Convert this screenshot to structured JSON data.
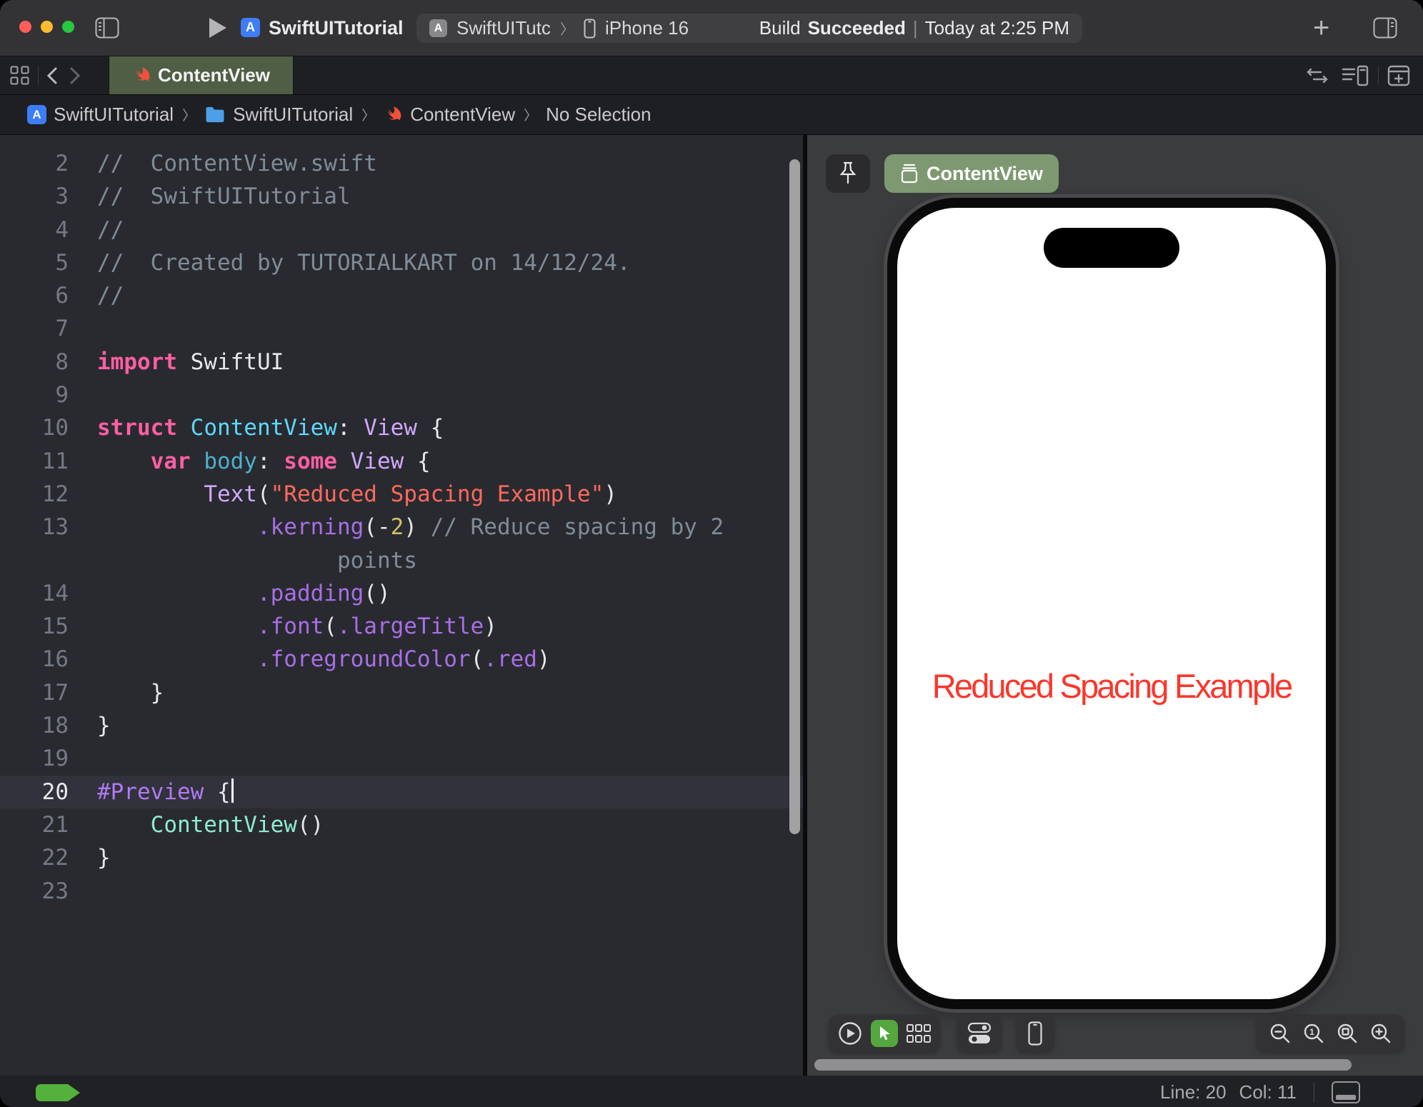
{
  "toolbar": {
    "app_title": "SwiftUITutorial",
    "scheme_name": "SwiftUITutc",
    "scheme_chevron": "〉",
    "device": "iPhone 16",
    "build_label": "Build",
    "build_status": "Succeeded",
    "build_sep": "|",
    "build_time": "Today at 2:25 PM",
    "plus_label": "+"
  },
  "tab_bar": {
    "active_tab": "ContentView"
  },
  "breadcrumb": {
    "items": [
      {
        "icon": "app-icon",
        "label": "SwiftUITutorial"
      },
      {
        "icon": "folder-icon",
        "label": "SwiftUITutorial"
      },
      {
        "icon": "swift-icon",
        "label": "ContentView"
      },
      {
        "icon": "",
        "label": "No Selection"
      }
    ]
  },
  "editor": {
    "lines": [
      {
        "num": "2",
        "tokens": [
          [
            "//  ContentView.swift",
            "comment"
          ]
        ]
      },
      {
        "num": "3",
        "tokens": [
          [
            "//  SwiftUITutorial",
            "comment"
          ]
        ]
      },
      {
        "num": "4",
        "tokens": [
          [
            "//",
            "comment"
          ]
        ]
      },
      {
        "num": "5",
        "tokens": [
          [
            "//  Created by TUTORIALKART on 14/12/24.",
            "comment"
          ]
        ]
      },
      {
        "num": "6",
        "tokens": [
          [
            "//",
            "comment"
          ]
        ]
      },
      {
        "num": "7",
        "tokens": []
      },
      {
        "num": "8",
        "tokens": [
          [
            "import",
            "kw"
          ],
          [
            " SwiftUI",
            "plain"
          ]
        ]
      },
      {
        "num": "9",
        "tokens": []
      },
      {
        "num": "10",
        "tokens": [
          [
            "struct ",
            "kw"
          ],
          [
            "ContentView",
            "type"
          ],
          [
            ": ",
            "plain"
          ],
          [
            "View",
            "typeref"
          ],
          [
            " {",
            "plain"
          ]
        ]
      },
      {
        "num": "11",
        "tokens": [
          [
            "    ",
            "plain"
          ],
          [
            "var ",
            "kw"
          ],
          [
            "body",
            "proj"
          ],
          [
            ": ",
            "plain"
          ],
          [
            "some ",
            "kw"
          ],
          [
            "View",
            "typeref"
          ],
          [
            " {",
            "plain"
          ]
        ]
      },
      {
        "num": "12",
        "tokens": [
          [
            "        ",
            "plain"
          ],
          [
            "Text",
            "typeref"
          ],
          [
            "(",
            "plain"
          ],
          [
            "\"Reduced Spacing Example\"",
            "str"
          ],
          [
            ")",
            "plain"
          ]
        ]
      },
      {
        "num": "13",
        "tokens": [
          [
            "            ",
            "plain"
          ],
          [
            ".kerning",
            "member"
          ],
          [
            "(",
            "plain"
          ],
          [
            "-",
            "plain"
          ],
          [
            "2",
            "num"
          ],
          [
            ") ",
            "plain"
          ],
          [
            "// Reduce spacing by 2",
            "comment"
          ]
        ]
      },
      {
        "num": "",
        "tokens": [
          [
            "                  ",
            "plain"
          ],
          [
            "points",
            "comment"
          ]
        ]
      },
      {
        "num": "14",
        "tokens": [
          [
            "            ",
            "plain"
          ],
          [
            ".padding",
            "member"
          ],
          [
            "()",
            "plain"
          ]
        ]
      },
      {
        "num": "15",
        "tokens": [
          [
            "            ",
            "plain"
          ],
          [
            ".font",
            "member"
          ],
          [
            "(",
            "plain"
          ],
          [
            ".largeTitle",
            "member"
          ],
          [
            ")",
            "plain"
          ]
        ]
      },
      {
        "num": "16",
        "tokens": [
          [
            "            ",
            "plain"
          ],
          [
            ".foregroundColor",
            "member"
          ],
          [
            "(",
            "plain"
          ],
          [
            ".red",
            "member"
          ],
          [
            ")",
            "plain"
          ]
        ]
      },
      {
        "num": "17",
        "tokens": [
          [
            "    }",
            "plain"
          ]
        ]
      },
      {
        "num": "18",
        "tokens": [
          [
            "}",
            "plain"
          ]
        ]
      },
      {
        "num": "19",
        "tokens": []
      },
      {
        "num": "20",
        "active": true,
        "tokens": [
          [
            "#Preview",
            "macro"
          ],
          [
            " {",
            "plain"
          ],
          [
            "",
            "caret"
          ]
        ]
      },
      {
        "num": "21",
        "tokens": [
          [
            "    ",
            "plain"
          ],
          [
            "ContentView",
            "mint"
          ],
          [
            "()",
            "plain"
          ]
        ]
      },
      {
        "num": "22",
        "tokens": [
          [
            "}",
            "plain"
          ]
        ]
      },
      {
        "num": "23",
        "tokens": []
      }
    ]
  },
  "preview": {
    "pill_label": "ContentView",
    "canvas_text": "Reduced Spacing Example"
  },
  "status_bar": {
    "line": "Line: 20",
    "col": "Col: 11"
  },
  "colors": {
    "tab_active_green": "#4f5e44",
    "preview_pill_green": "#7e9971",
    "canvas_text_red": "#fb362b",
    "selected_tool_green": "#55a63e",
    "breakpoint_badge_green": "#53b13c",
    "string_red": "#fc6a5d",
    "keyword_pink": "#fc5fa3",
    "type_cyan": "#5dd8ff",
    "member_purple": "#a86fe8"
  }
}
